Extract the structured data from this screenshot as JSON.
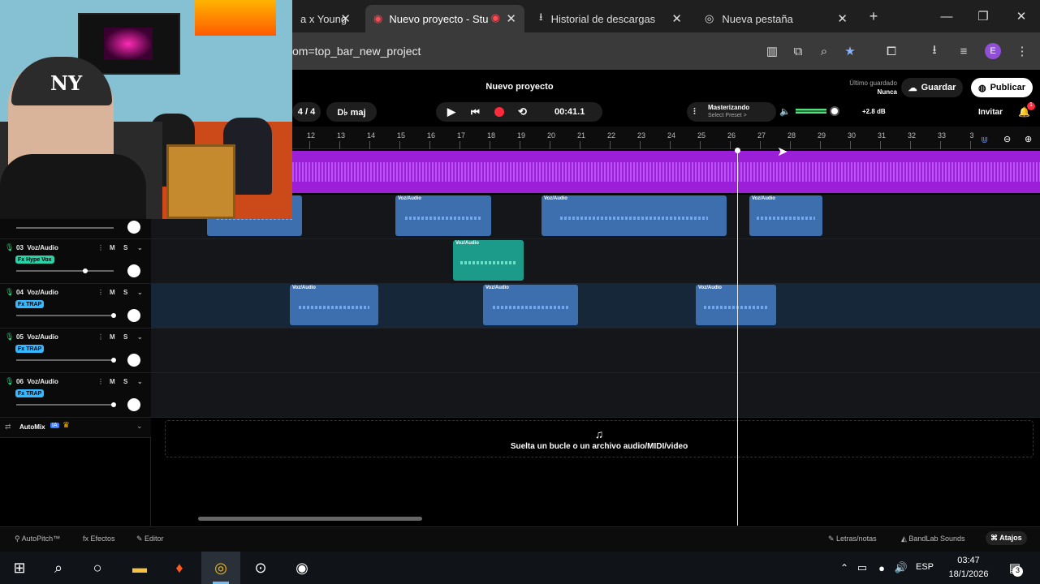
{
  "browser": {
    "tabs": [
      {
        "title": "a x Young"
      },
      {
        "title": "Nuevo proyecto - Stu"
      },
      {
        "title": "Historial de descargas"
      },
      {
        "title": "Nueva pestaña"
      }
    ],
    "url": "om=top_bar_new_project",
    "profile_initial": "E"
  },
  "app": {
    "project_title": "Nuevo proyecto",
    "last_saved_label": "Último guardado",
    "last_saved_value": "Nunca",
    "save_label": "Guardar",
    "publish_label": "Publicar",
    "invite_label": "Invitar",
    "notification_count": "1",
    "time_signature": "4 / 4",
    "key": "D♭ maj",
    "time": "00:41.1",
    "mastering_label": "Masterizando",
    "mastering_preset": "Select Preset >",
    "gain": "+2.8 dB",
    "ruler": [
      "12",
      "13",
      "14",
      "15",
      "16",
      "17",
      "18",
      "19",
      "20",
      "21",
      "22",
      "23",
      "24",
      "25",
      "26",
      "27",
      "28",
      "29",
      "30",
      "31",
      "32",
      "33",
      "3"
    ],
    "tracks": [
      {
        "number": "03",
        "name": "Voz/Audio",
        "fx": "Fx Hype Vox",
        "fx_color": "#2bd2a8"
      },
      {
        "number": "04",
        "name": "Voz/Audio",
        "fx": "Fx TRAP",
        "fx_color": "#34b8ff"
      },
      {
        "number": "05",
        "name": "Voz/Audio",
        "fx": "Fx TRAP",
        "fx_color": "#34b8ff"
      },
      {
        "number": "06",
        "name": "Voz/Audio",
        "fx": "Fx TRAP",
        "fx_color": "#34b8ff"
      }
    ],
    "clip_label": "Voz/Audio",
    "mute_label": "M",
    "solo_label": "S",
    "automix_label": "AutoMix",
    "ia_badge": "IA",
    "drop_text": "Suelta un bucle o un archivo audio/MIDI/video",
    "bottom": {
      "autopitch": "AutoPitch™",
      "effects": "Efectos",
      "editor": "Editor",
      "lyrics": "Letras/notas",
      "sounds": "BandLab Sounds",
      "shortcuts": "Atajos"
    }
  },
  "taskbar": {
    "language": "ESP",
    "time": "03:47",
    "date": "18/1/2026",
    "notifications": "3"
  }
}
